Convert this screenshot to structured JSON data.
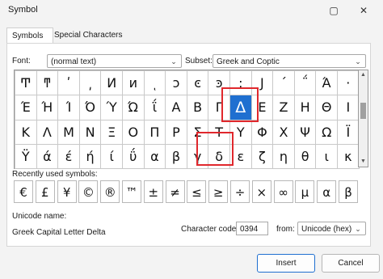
{
  "window": {
    "title": "Symbol",
    "close_icon": "close-icon",
    "restore_icon": "restore-icon"
  },
  "tabs": [
    {
      "label": "Symbols",
      "active": true
    },
    {
      "label": "Special Characters",
      "active": false
    }
  ],
  "font": {
    "label": "Font:",
    "value": "(normal text)"
  },
  "subset": {
    "label": "Subset:",
    "value": "Greek and Coptic"
  },
  "grid": {
    "rows": [
      [
        "Ͳ",
        "ͳ",
        "ʹ",
        "͵",
        "Ͷ",
        "ͷ",
        "ͺ",
        "ͻ",
        "ͼ",
        "ͽ",
        ";",
        "Ϳ",
        "΄",
        "΅",
        "Ά",
        "·"
      ],
      [
        "Έ",
        "Ή",
        "Ί",
        "Ό",
        "Ύ",
        "Ώ",
        "ΐ",
        "Α",
        "Β",
        "Γ",
        "Δ",
        "Ε",
        "Ζ",
        "Η",
        "Θ",
        "Ι"
      ],
      [
        "Κ",
        "Λ",
        "Μ",
        "Ν",
        "Ξ",
        "Ο",
        "Π",
        "Ρ",
        "Σ",
        "Τ",
        "Υ",
        "Φ",
        "Χ",
        "Ψ",
        "Ω",
        "Ϊ"
      ],
      [
        "Ϋ",
        "ά",
        "έ",
        "ή",
        "ί",
        "ΰ",
        "α",
        "β",
        "γ",
        "δ",
        "ε",
        "ζ",
        "η",
        "θ",
        "ι",
        "κ"
      ]
    ],
    "selected": {
      "row": 1,
      "col": 10
    }
  },
  "recent": {
    "label": "Recently used symbols:",
    "items": [
      "€",
      "£",
      "¥",
      "©",
      "®",
      "™",
      "±",
      "≠",
      "≤",
      "≥",
      "÷",
      "×",
      "∞",
      "µ",
      "α",
      "β"
    ]
  },
  "unicode_name": {
    "label": "Unicode name:",
    "value": "Greek Capital Letter Delta"
  },
  "char_code": {
    "label": "Character code:",
    "value": "0394"
  },
  "from": {
    "label": "from:",
    "value": "Unicode (hex)"
  },
  "buttons": {
    "insert": "Insert",
    "cancel": "Cancel"
  },
  "highlight_color": "#e0282d",
  "selection_color": "#1f6fd0"
}
